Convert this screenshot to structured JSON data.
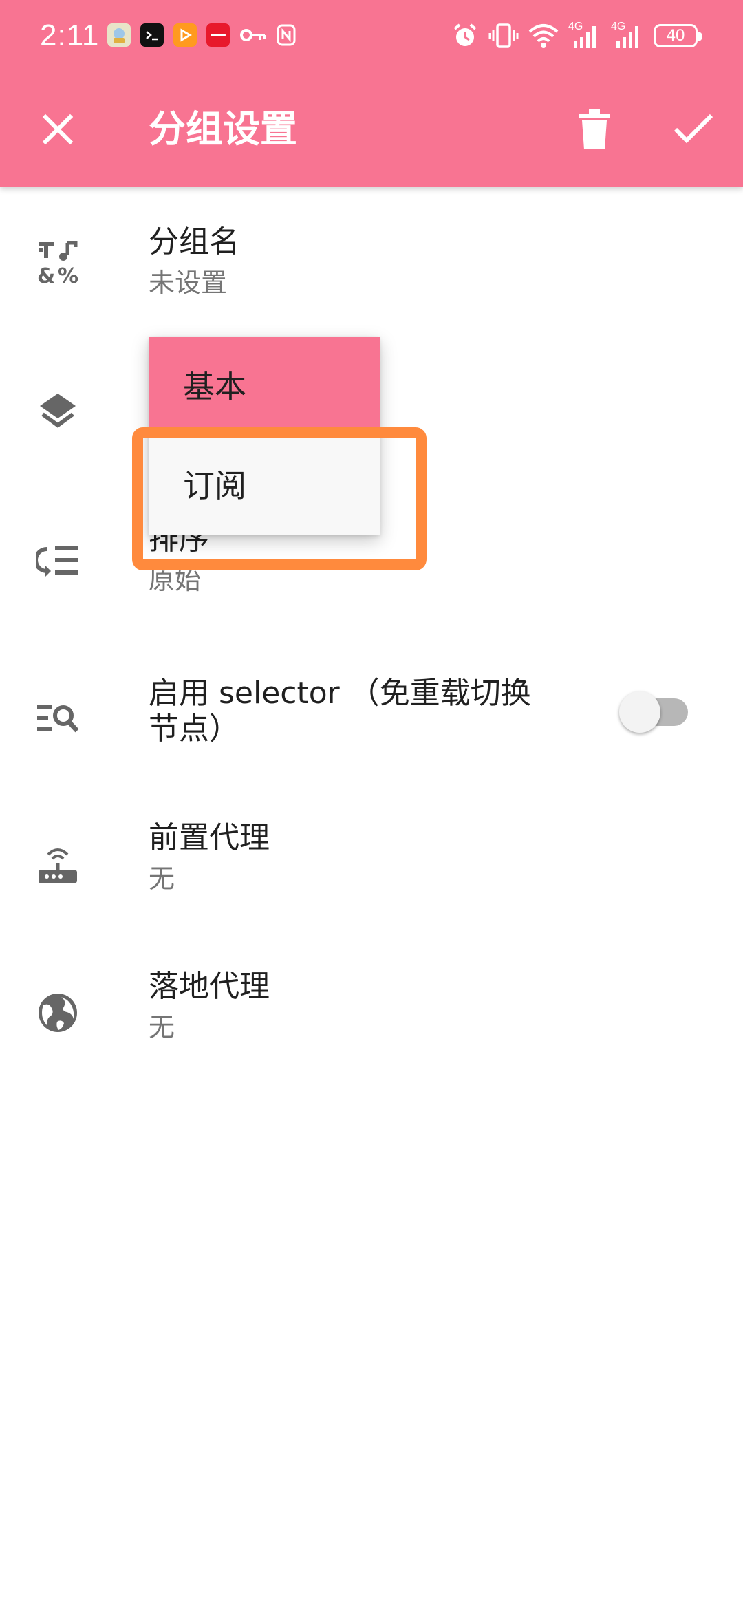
{
  "status_bar": {
    "time": "2:11",
    "battery_level": "40",
    "network_labels": [
      "4G",
      "4G"
    ],
    "notification_icons": [
      "app-icon",
      "terminal-icon",
      "video-app-icon",
      "xiaohongshu-icon",
      "key-icon",
      "nfc-icon"
    ],
    "system_icons": [
      "alarm-icon",
      "vibrate-icon",
      "wifi-icon",
      "signal-4g-icon",
      "signal-4g-icon",
      "battery-icon"
    ]
  },
  "toolbar": {
    "title": "分组设置",
    "close_icon": "close-icon",
    "delete_icon": "trash-icon",
    "confirm_icon": "check-icon",
    "background_color": "#F87492"
  },
  "settings": [
    {
      "key": "group_name",
      "title": "分组名",
      "subtitle": "未设置",
      "icon": "text-format-icon"
    },
    {
      "key": "group_type",
      "title": "",
      "subtitle": "",
      "icon": "layers-icon"
    },
    {
      "key": "sort",
      "title": "排序",
      "subtitle": "原始",
      "icon": "sort-icon"
    },
    {
      "key": "selector",
      "title": "启用 selector （免重载切换节点）",
      "title_line1": "启用 selector （免重载切换",
      "title_line2": "节点）",
      "icon": "search-list-icon",
      "toggle_on": false
    },
    {
      "key": "front_proxy",
      "title": "前置代理",
      "subtitle": "无",
      "icon": "router-icon"
    },
    {
      "key": "landing_proxy",
      "title": "落地代理",
      "subtitle": "无",
      "icon": "globe-icon"
    }
  ],
  "dropdown": {
    "options": [
      "基本",
      "订阅"
    ],
    "selected": "基本",
    "selected_color": "#F87492",
    "highlighted_option": "订阅",
    "highlight_color": "#FF8A3D"
  }
}
